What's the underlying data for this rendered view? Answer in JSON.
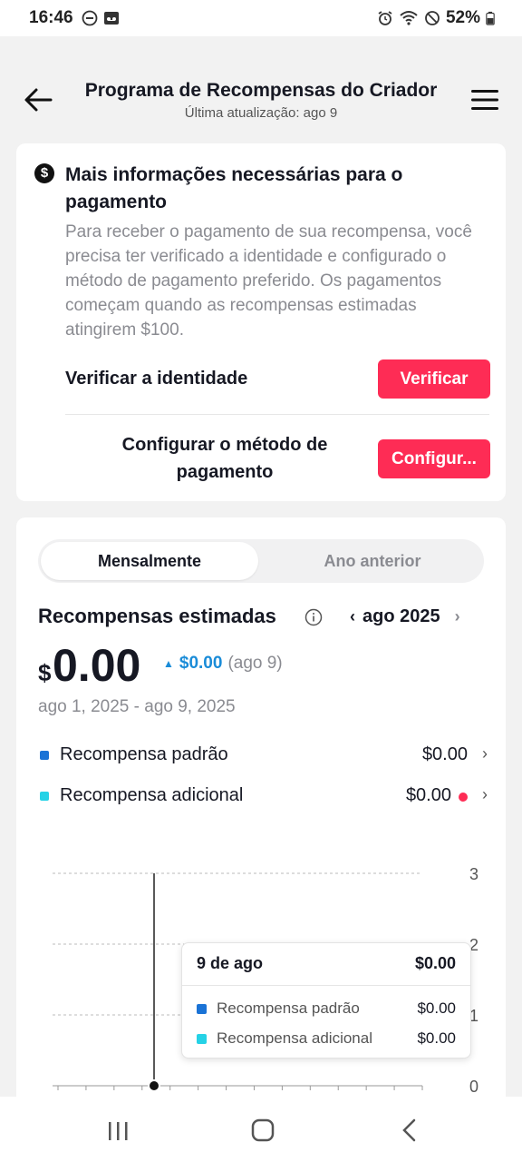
{
  "status_bar": {
    "time": "16:46",
    "battery": "52%"
  },
  "header": {
    "title": "Programa de Recompensas do Criador",
    "subtitle": "Última atualização: ago 9"
  },
  "info_card": {
    "title": "Mais informações necessárias para o pagamento",
    "description": "Para receber o pagamento de sua recompensa, você precisa ter verificado a identidade e configurado o método de pagamento preferido. Os pagamentos começam quando as recompensas estimadas atingirem $100.",
    "verify_label": "Verificar a identidade",
    "verify_button": "Verificar",
    "config_label": "Configurar o método de pagamento",
    "config_button": "Configur..."
  },
  "rewards": {
    "tabs": [
      {
        "label": "Mensalmente",
        "active": true
      },
      {
        "label": "Ano anterior",
        "active": false
      }
    ],
    "title": "Recompensas estimadas",
    "month": "ago 2025",
    "currency": "$",
    "amount": "0.00",
    "delta_value": "$0.00",
    "delta_date": "(ago 9)",
    "range": "ago 1, 2025 - ago 9, 2025",
    "legend": [
      {
        "label": "Recompensa padrão",
        "value": "$0.00",
        "color": "#1a73d6"
      },
      {
        "label": "Recompensa adicional",
        "value": "$0.00",
        "color": "#25d2e6"
      }
    ]
  },
  "chart_data": {
    "type": "bar",
    "y_ticks": [
      "3",
      "2",
      "1",
      "0"
    ],
    "ylim": [
      0,
      3
    ],
    "grid": true,
    "series": [
      {
        "name": "Recompensa padrão",
        "values": [
          0
        ]
      },
      {
        "name": "Recompensa adicional",
        "values": [
          0
        ]
      }
    ],
    "tooltip": {
      "date": "9 de ago",
      "total": "$0.00",
      "rows": [
        {
          "label": "Recompensa padrão",
          "value": "$0.00",
          "color": "#1a73d6"
        },
        {
          "label": "Recompensa adicional",
          "value": "$0.00",
          "color": "#25d2e6"
        }
      ]
    }
  }
}
